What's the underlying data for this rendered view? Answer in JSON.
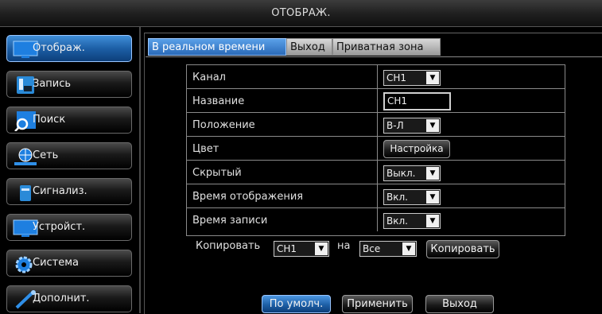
{
  "window": {
    "title": "ОТОБРАЖ."
  },
  "sidebar": {
    "items": [
      {
        "label": "Отображ.",
        "icon": "monitor-icon",
        "active": true
      },
      {
        "label": "Запись",
        "icon": "record-icon",
        "active": false
      },
      {
        "label": "Поиск",
        "icon": "search-icon",
        "active": false
      },
      {
        "label": "Сеть",
        "icon": "network-icon",
        "active": false
      },
      {
        "label": "Сигнализ.",
        "icon": "alarm-icon",
        "active": false
      },
      {
        "label": "Устройст.",
        "icon": "device-icon",
        "active": false
      },
      {
        "label": "Система",
        "icon": "system-gear-icon",
        "active": false
      },
      {
        "label": "Дополнит.",
        "icon": "advanced-tools-icon",
        "active": false
      }
    ]
  },
  "tabs": [
    {
      "label": "В реальном времени",
      "active": true
    },
    {
      "label": "Выход",
      "active": false
    },
    {
      "label": "Приватная зона",
      "active": false
    }
  ],
  "settings": {
    "rows": [
      {
        "label": "Канал",
        "control": "select",
        "value": "CH1"
      },
      {
        "label": "Название",
        "control": "text",
        "value": "CH1"
      },
      {
        "label": "Положение",
        "control": "select",
        "value": "В-Л"
      },
      {
        "label": "Цвет",
        "control": "button",
        "value": "Настройка"
      },
      {
        "label": "Скрытый",
        "control": "select",
        "value": "Выкл."
      },
      {
        "label": "Время отображения",
        "control": "select",
        "value": "Вкл."
      },
      {
        "label": "Время записи",
        "control": "select",
        "value": "Вкл."
      }
    ]
  },
  "copy": {
    "label": "Копировать",
    "from_value": "CH1",
    "to_label": "на",
    "to_value": "Все",
    "button": "Копировать"
  },
  "footer": {
    "default_label": "По умолч.",
    "apply_label": "Применить",
    "exit_label": "Выход"
  },
  "colors": {
    "accent": "#2a6ab8",
    "panel": "#000000",
    "border": "#8a8a8a"
  }
}
